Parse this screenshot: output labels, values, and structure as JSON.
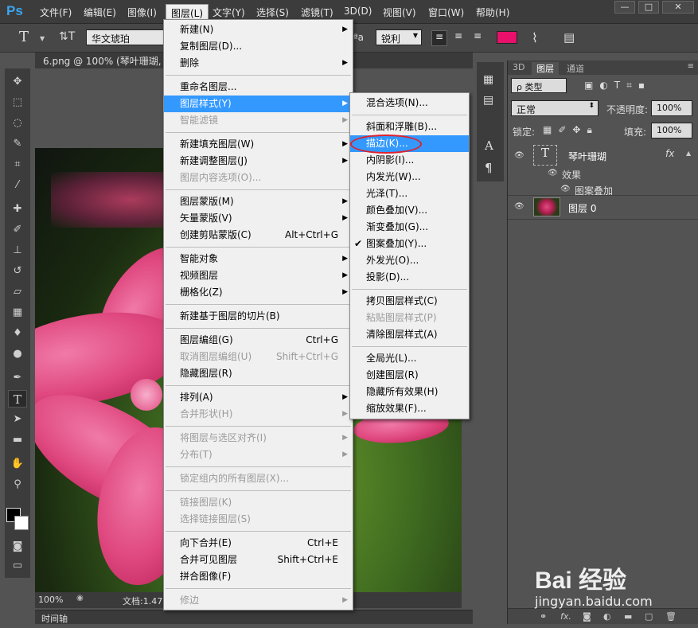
{
  "app": {
    "logo": "Ps"
  },
  "menubar": {
    "items": [
      "文件(F)",
      "编辑(E)",
      "图像(I)",
      "图层(L)",
      "文字(Y)",
      "选择(S)",
      "滤镜(T)",
      "3D(D)",
      "视图(V)",
      "窗口(W)",
      "帮助(H)"
    ],
    "active": "图层(L)"
  },
  "window_controls": {
    "minimize": "—",
    "maximize": "□",
    "close": "✕"
  },
  "options": {
    "tool_glyph": "T",
    "font_name": "华文琥珀",
    "aa_label": "ªa",
    "aa_value": "锐利",
    "text_color": "#e8106a"
  },
  "document": {
    "tab_title": "6.png @ 100% (琴叶珊瑚, ",
    "zoom": "100%",
    "doc_info": "文档:1.47",
    "timeline_label": "时间轴"
  },
  "panel": {
    "tabs": [
      "3D",
      "图层",
      "通道"
    ],
    "active_tab": "图层",
    "filter_label": "ρ 类型",
    "blend_mode": "正常",
    "opacity_label": "不透明度:",
    "opacity_value": "100%",
    "lock_label": "锁定:",
    "fill_label": "填充:",
    "fill_value": "100%",
    "layers": [
      {
        "name": "琴叶珊瑚",
        "type": "text",
        "fx": "fx",
        "effects_label": "效果",
        "effects": [
          "图案叠加"
        ]
      },
      {
        "name": "图层 0",
        "type": "image"
      }
    ]
  },
  "layer_menu": {
    "items": [
      {
        "label": "新建(N)",
        "arrow": true
      },
      {
        "label": "复制图层(D)..."
      },
      {
        "label": "删除",
        "arrow": true
      },
      {
        "sep": true
      },
      {
        "label": "重命名图层..."
      },
      {
        "label": "图层样式(Y)",
        "arrow": true,
        "highlight": true
      },
      {
        "label": "智能滤镜",
        "arrow": true,
        "disabled": true
      },
      {
        "sep": true
      },
      {
        "label": "新建填充图层(W)",
        "arrow": true
      },
      {
        "label": "新建调整图层(J)",
        "arrow": true
      },
      {
        "label": "图层内容选项(O)...",
        "disabled": true
      },
      {
        "sep": true
      },
      {
        "label": "图层蒙版(M)",
        "arrow": true
      },
      {
        "label": "矢量蒙版(V)",
        "arrow": true
      },
      {
        "label": "创建剪贴蒙版(C)",
        "shortcut": "Alt+Ctrl+G"
      },
      {
        "sep": true
      },
      {
        "label": "智能对象",
        "arrow": true
      },
      {
        "label": "视频图层",
        "arrow": true
      },
      {
        "label": "栅格化(Z)",
        "arrow": true
      },
      {
        "sep": true
      },
      {
        "label": "新建基于图层的切片(B)"
      },
      {
        "sep": true
      },
      {
        "label": "图层编组(G)",
        "shortcut": "Ctrl+G"
      },
      {
        "label": "取消图层编组(U)",
        "shortcut": "Shift+Ctrl+G",
        "disabled": true
      },
      {
        "label": "隐藏图层(R)"
      },
      {
        "sep": true
      },
      {
        "label": "排列(A)",
        "arrow": true
      },
      {
        "label": "合并形状(H)",
        "arrow": true,
        "disabled": true
      },
      {
        "sep": true
      },
      {
        "label": "将图层与选区对齐(I)",
        "arrow": true,
        "disabled": true
      },
      {
        "label": "分布(T)",
        "arrow": true,
        "disabled": true
      },
      {
        "sep": true
      },
      {
        "label": "锁定组内的所有图层(X)...",
        "disabled": true
      },
      {
        "sep": true
      },
      {
        "label": "链接图层(K)",
        "disabled": true
      },
      {
        "label": "选择链接图层(S)",
        "disabled": true
      },
      {
        "sep": true
      },
      {
        "label": "向下合并(E)",
        "shortcut": "Ctrl+E"
      },
      {
        "label": "合并可见图层",
        "shortcut": "Shift+Ctrl+E"
      },
      {
        "label": "拼合图像(F)"
      },
      {
        "sep": true
      },
      {
        "label": "修边",
        "arrow": true,
        "disabled": true
      }
    ]
  },
  "style_menu": {
    "items": [
      {
        "label": "混合选项(N)..."
      },
      {
        "sep": true
      },
      {
        "label": "斜面和浮雕(B)..."
      },
      {
        "label": "描边(K)...",
        "highlight": true
      },
      {
        "label": "内阴影(I)..."
      },
      {
        "label": "内发光(W)..."
      },
      {
        "label": "光泽(T)..."
      },
      {
        "label": "颜色叠加(V)..."
      },
      {
        "label": "渐变叠加(G)..."
      },
      {
        "label": "图案叠加(Y)...",
        "checked": true
      },
      {
        "label": "外发光(O)..."
      },
      {
        "label": "投影(D)..."
      },
      {
        "sep": true
      },
      {
        "label": "拷贝图层样式(C)"
      },
      {
        "label": "粘贴图层样式(P)",
        "disabled": true
      },
      {
        "label": "清除图层样式(A)"
      },
      {
        "sep": true
      },
      {
        "label": "全局光(L)..."
      },
      {
        "label": "创建图层(R)"
      },
      {
        "label": "隐藏所有效果(H)"
      },
      {
        "label": "缩放效果(F)..."
      }
    ]
  },
  "watermark": {
    "brand": "Bai 经验",
    "url": "jingyan.baidu.com"
  }
}
